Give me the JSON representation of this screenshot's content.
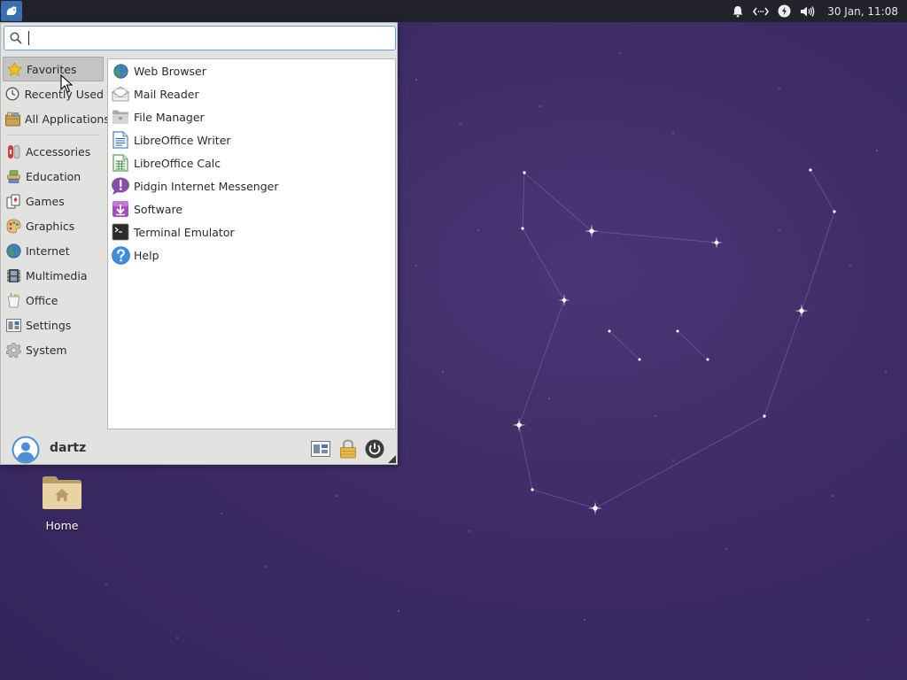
{
  "panel": {
    "menu_icon": "xfce-mouse-icon",
    "tray_icons": [
      "bell-icon",
      "network-icon",
      "power-icon",
      "volume-icon"
    ],
    "clock": "30 Jan, 11:08"
  },
  "search": {
    "value": "",
    "icon": "search-icon"
  },
  "categories": [
    {
      "label": "Favorites",
      "icon": "star-icon",
      "active": true
    },
    {
      "label": "Recently Used",
      "icon": "clock-icon"
    },
    {
      "label": "All Applications",
      "icon": "applications-icon"
    },
    {
      "label": "Accessories",
      "icon": "accessories-icon"
    },
    {
      "label": "Education",
      "icon": "education-icon"
    },
    {
      "label": "Games",
      "icon": "games-icon"
    },
    {
      "label": "Graphics",
      "icon": "graphics-icon"
    },
    {
      "label": "Internet",
      "icon": "globe-icon"
    },
    {
      "label": "Multimedia",
      "icon": "multimedia-icon"
    },
    {
      "label": "Office",
      "icon": "office-icon"
    },
    {
      "label": "Settings",
      "icon": "settings-icon"
    },
    {
      "label": "System",
      "icon": "gear-icon"
    }
  ],
  "apps": [
    {
      "label": "Web Browser",
      "icon": "globe-icon"
    },
    {
      "label": "Mail Reader",
      "icon": "mail-icon"
    },
    {
      "label": "File Manager",
      "icon": "folder-icon"
    },
    {
      "label": "LibreOffice Writer",
      "icon": "writer-icon"
    },
    {
      "label": "LibreOffice Calc",
      "icon": "calc-icon"
    },
    {
      "label": "Pidgin Internet Messenger",
      "icon": "pidgin-icon"
    },
    {
      "label": "Software",
      "icon": "software-icon"
    },
    {
      "label": "Terminal Emulator",
      "icon": "terminal-icon"
    },
    {
      "label": "Help",
      "icon": "help-icon"
    }
  ],
  "user": {
    "name": "dartz",
    "avatar_icon": "user-avatar-icon"
  },
  "footer_buttons": [
    "settings-manager-icon",
    "lock-icon",
    "logout-icon"
  ],
  "desktop": {
    "home_label": "Home"
  },
  "colors": {
    "panel": "#21222b",
    "desktop": "#3d2c66",
    "accent": "#3b6fb3"
  }
}
